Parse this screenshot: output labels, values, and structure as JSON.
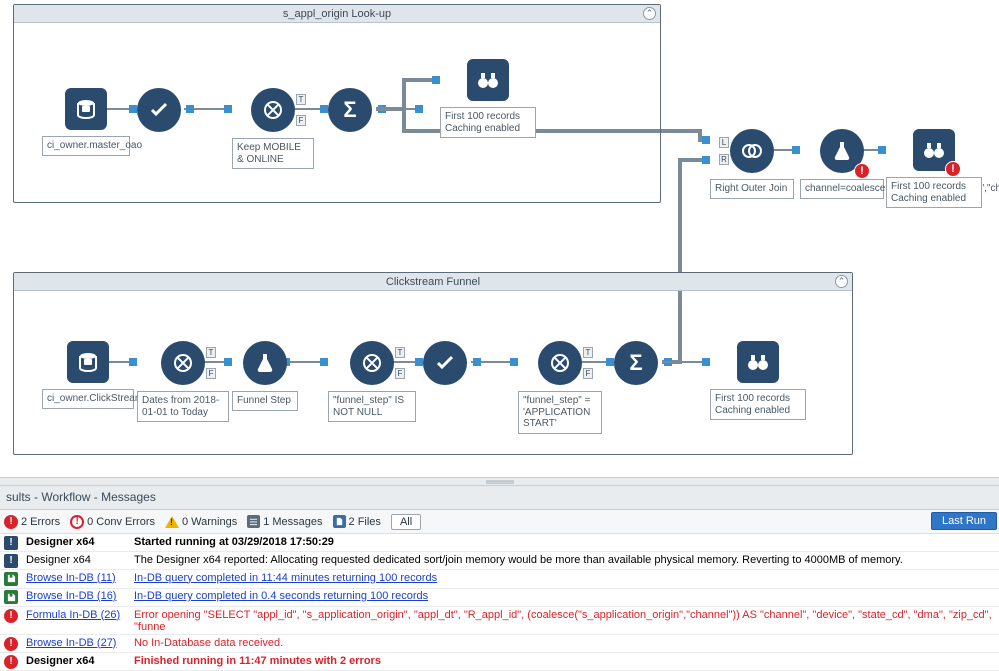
{
  "groups": {
    "top": {
      "title": "s_appl_origin Look-up"
    },
    "bottom": {
      "title": "Clickstream Funnel"
    }
  },
  "tools": {
    "t1": {
      "label": "ci_owner.master_oao"
    },
    "t4": {
      "label": "Keep MOBILE & ONLINE"
    },
    "t6": {
      "label": "First 100 records Caching enabled"
    },
    "join": {
      "label": "Right Outer Join"
    },
    "formula": {
      "label": "channel=coalesce(\"s_application_origin\",\"channel\")"
    },
    "browse2": {
      "label": "First 100 records Caching enabled"
    },
    "b1": {
      "label": "ci_owner.ClickStream"
    },
    "b2": {
      "label": "Dates from 2018-01-01 to Today"
    },
    "b3": {
      "label": "Funnel Step"
    },
    "b4": {
      "label": "\"funnel_step\" IS NOT NULL"
    },
    "b6": {
      "label": "\"funnel_step\" = 'APPLICATION START'"
    },
    "b8": {
      "label": "First 100 records Caching enabled"
    }
  },
  "results": {
    "title": "sults - Workflow - Messages",
    "toolbar": {
      "errors": "2 Errors",
      "conv": "0 Conv Errors",
      "warnings": "0 Warnings",
      "messages": "1 Messages",
      "files": "2 Files",
      "all": "All",
      "lastrun": "Last Run"
    },
    "rows": [
      {
        "icon": "info",
        "src": "Designer x64",
        "msg": "Started running at 03/29/2018 17:50:29",
        "bold": true
      },
      {
        "icon": "info",
        "src": "Designer x64",
        "msg": "The Designer x64 reported: Allocating requested dedicated sort/join memory would be more than available physical memory.  Reverting to 4000MB of memory."
      },
      {
        "icon": "save",
        "srcLink": "Browse In-DB (11)",
        "msgLink": "In-DB query completed in 11:44 minutes returning 100 records"
      },
      {
        "icon": "save",
        "srcLink": "Browse In-DB (16)",
        "msgLink": "In-DB query completed in 0.4 seconds returning 100 records"
      },
      {
        "icon": "error",
        "srcLink": "Formula In-DB (26)",
        "msgErr": "Error opening \"SELECT \"appl_id\", \"s_application_origin\", \"appl_dt\", \"R_appl_id\", (coalesce(\"s_application_origin\",\"channel\")) AS \"channel\", \"device\", \"state_cd\", \"dma\", \"zip_cd\", \"funne"
      },
      {
        "icon": "error",
        "srcLink": "Browse In-DB (27)",
        "msgErr": "No In-Database data received."
      },
      {
        "icon": "error",
        "src": "Designer x64",
        "msgErr": "Finished running in 11:47 minutes with 2 errors",
        "bold": true
      }
    ]
  }
}
